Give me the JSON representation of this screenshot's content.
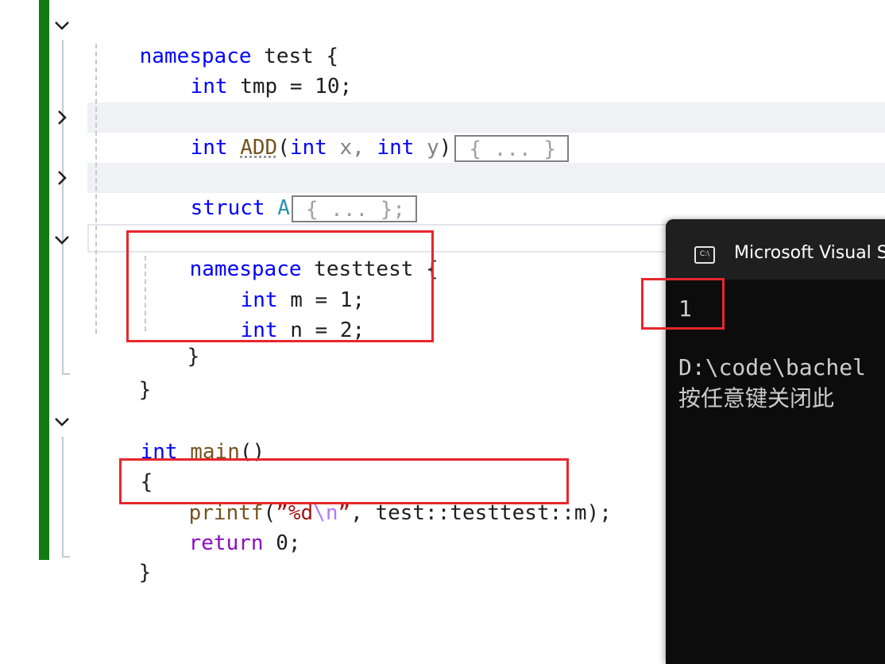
{
  "editor": {
    "lines": {
      "l1": {
        "kw": "namespace",
        "rest": " test {"
      },
      "l2": {
        "kw": "int",
        "rest": " tmp = 10;"
      },
      "l3": {
        "kw1": "int",
        "fn": "ADD",
        "p1": "(",
        "kw2": "int",
        "x": " x, ",
        "kw3": "int",
        "y": " y",
        "p2": ")",
        "collapsed": "{ ... }"
      },
      "l4": {
        "kw": "struct",
        "ty": " A",
        "collapsed": "{ ... };"
      },
      "l5": {
        "kw": "namespace",
        "rest": " testtest {"
      },
      "l6": {
        "kw": "int",
        "rest": " m = 1;"
      },
      "l7": {
        "kw": "int",
        "rest": " n = 2;"
      },
      "l8": {
        "rest": "}"
      },
      "l9": {
        "rest": "}"
      },
      "l10": {
        "kw": "int",
        "fn": " main",
        "rest": "()"
      },
      "l11": {
        "rest": "{"
      },
      "l12": {
        "fn": "printf",
        "p1": "(",
        "s1": "”%d",
        "esc": "\\n",
        "s2": "”",
        "rest": ", test::testtest::m);"
      },
      "l13": {
        "ctrl": "return",
        "rest": " 0;"
      },
      "l14": {
        "rest": "}"
      }
    },
    "fold_icons": [
      "chevron-down-icon",
      "chevron-right-icon",
      "chevron-right-icon",
      "chevron-down-icon",
      "chevron-down-icon"
    ]
  },
  "console": {
    "title": "Microsoft Visual S",
    "icon_text": "C:\\",
    "output": "1",
    "path": "D:\\code\\bachel",
    "prompt": "按任意键关闭此"
  },
  "colors": {
    "keyword": "#0000ff",
    "function": "#74531f",
    "string": "#a31515",
    "escape": "#b776fb",
    "control": "#8f08c4",
    "change_bar": "#107c10",
    "annotation_box": "#e8262d",
    "console_bg": "#0c0c0c"
  }
}
